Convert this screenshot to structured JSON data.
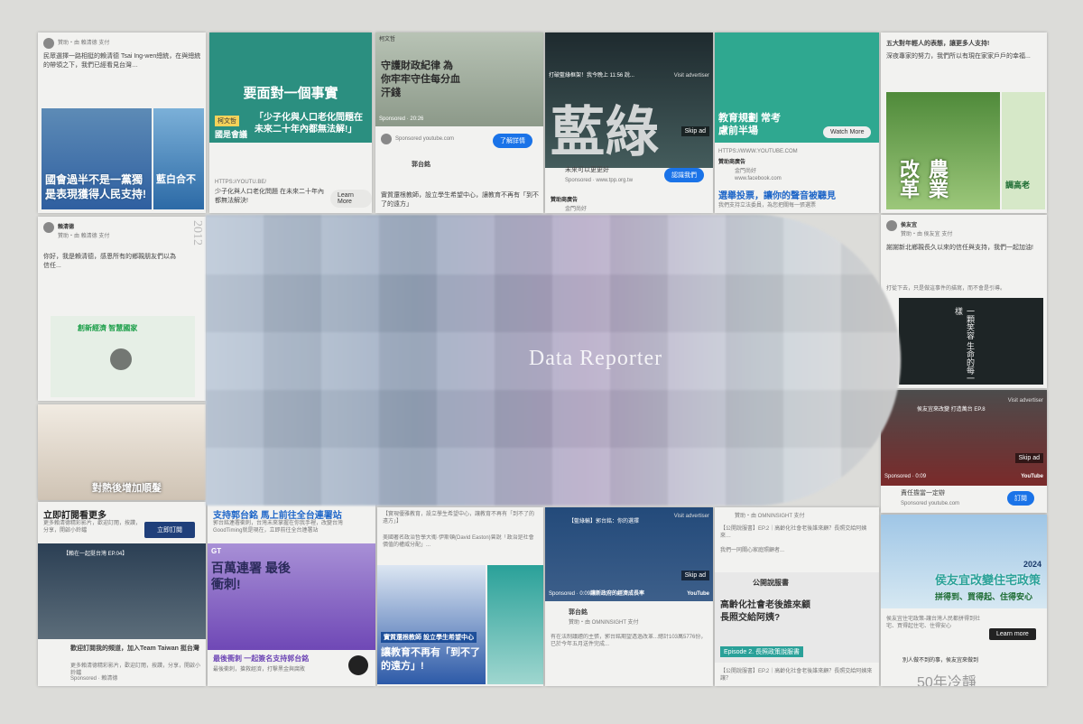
{
  "overlay_label": "Data Reporter",
  "cards": {
    "c1": {
      "header": "贊助・由 賴清德 支付",
      "body": "民眾選擇一路相挺的賴清德 Tsai Ing-wen總統，在與總統的帶領之下，我們已經看見台灣…",
      "caption1": "國會過半不是一黨獨大",
      "caption2": "是表現獲得人民支持!",
      "side": "藍白合不"
    },
    "c2": {
      "title": "要面對一個事實",
      "name_tag": "柯文哲",
      "tag2": "國是會議",
      "quote": "「少子化與人口老化問題在未來二十年內都無法解!」",
      "url": "HTTPS://YOUTU.BE/",
      "desc": "少子化與人口老化問題 在未來二十年內都無法解決!",
      "cta": "Learn More"
    },
    "c3": {
      "label": "柯文哲",
      "quote": "守護財政紀律 為你牢牢守住每分血汗錢",
      "sponsored": "Sponsored · 20:26",
      "sponsor_line": "Sponsored youtube.com",
      "cta": "了解詳情",
      "name": "郭台銘",
      "desc": "實質還根教師，設立學生希望中心，讓教育不再有「到不了的遠方」"
    },
    "c4": {
      "ad": "Visit advertiser",
      "title": "打破藍綠框架！我今晚上 11:56 說...",
      "skip": "Skip ad",
      "big": "藍綠",
      "desc": "未來可以更更好",
      "sponsored": "Sponsored · www.tpp.org.tw",
      "cta": "認識我們",
      "sponsor_group": "贊助商廣告",
      "name": "金門尚好"
    },
    "c5": {
      "title": "教育規劃 常考慮前半場",
      "watch": "Watch More",
      "url": "HTTPS://WWW.YOUTUBE.COM",
      "sponsor_group": "贊助商廣告",
      "name": "金門尚好",
      "site": "www.facebook.com",
      "headline": "選舉投票，讓你的聲音被聽見",
      "desc": "我們支持立法委員，為您把關每一張選票"
    },
    "c6": {
      "header": "五大對年輕人的表態，讓更多人支持!",
      "body": "深夜專家的努力，我們所以有現在家家戶戶的幸福...",
      "big": "農業改革",
      "side": "調高老"
    },
    "c7": {
      "name": "賴清德",
      "header": "贊助・由 賴清德 支付",
      "body": "你好，我是賴清德，感恩所有的鄉親朋友們以為信任...",
      "badge": "創新經濟 智慧國家",
      "vertical": "2012"
    },
    "c8": {
      "name": "侯友宜",
      "header": "贊助・由 侯友宜 支付",
      "body": "謝謝新北鄉親長久以來的信任與支持，我們一起加油!",
      "bottom": "打從下去，只是做這事件的描寫，而不會是引導。",
      "poster": "一顆笑容 生命的每一樣"
    },
    "c9": {
      "ad": "Visit advertiser",
      "title": "侯友宜來改變 打造萬台 EP.8",
      "skip": "Skip ad",
      "yt": "YouTube",
      "sponsored": "Sponsored · 0:09",
      "cta": "訂閱",
      "desc": "責任擔當一定辦",
      "sponsor": "Sponsored youtube.com"
    },
    "c10": {
      "caption": "對熱後增加順髮"
    },
    "c11": {
      "title": "立即訂閱看更多",
      "desc": "更多賴清德精彩影片，歡迎訂閱，按讚，分享，開啟小鈴鐺",
      "cta": "立即訂閱",
      "video": "【賴在一起挺台灣 EP.04】",
      "footer_title": "歡迎訂閱我的頻道，加入Team Taiwan 挺台灣",
      "footer_desc": "更多賴清德精彩影片，歡迎訂閱，按讚，分享，開啟小鈴鐺",
      "sponsored": "Sponsored · 賴清德"
    },
    "c12": {
      "title": "支持郭台銘 馬上前往全台連署站",
      "desc": "郭台銘連署衝刺，台灣未來掌握在你我手裡，改變台灣GoodTiming就是現在，立即前往全台連署站",
      "tag": "GT",
      "big": "百萬連署 最後衝刺!",
      "footer": "最後衝刺 一起簽名支持郭台銘",
      "sub": "最後衝刺，搶救經濟，打擊黑金與腐敗"
    },
    "c13": {
      "header": "【實現優雅教育，設立學生希望中心，讓教育不再有「到不了的遠方」】",
      "body": "美國著名政治哲學大衛·伊斯頓(David Easton)曾說「政治是社會價值的權威分配」...",
      "banner": "實質還根教師 設立學生希望中心",
      "big": "讓教育不再有「到不了的遠方」!"
    },
    "c14": {
      "title": "【藍綠輸】郭台銘：你的選擇",
      "ad": "Visit advertiser",
      "skip": "Skip ad",
      "yt": "YouTube",
      "sponsored": "Sponsored · 0:09",
      "caption": "讓新政府的經濟成長率",
      "name": "郭台銘",
      "header": "贊助・由 OMNINSIGHT 支付",
      "body": "有在法制議題的主張，郭台銘期望透過改革...總計103萬5776份，已於今年五月送件完成..."
    },
    "c15": {
      "header": "贊助・由 OMNINSIGHT 支付",
      "body": "【公開說服書】EP.2｜高齡化社會老後誰來顧？長照交給阿姨來…",
      "desc": "我們一同關心家庭照顧者...",
      "label": "公開說服書",
      "big": "高齡化社會老後誰來顧 長照交給阿姨?",
      "episode": "Episode 2. 長照政策說服書",
      "footer": "【公開說服書】EP.2｜高齡化社會老後誰來顧？長照交給阿姨來讓？"
    },
    "c16": {
      "big": "侯友宜改變住宅政策",
      "sub": "拼得到、買得起、住得安心",
      "year": "2024",
      "desc": "侯友宜住宅政策-讓台灣人民都拼得到社宅、買得起住宅、住得安心",
      "cta": "Learn more",
      "bottom": "別人做不到的事，侯友宜來做到",
      "bottom_big": "50年冷靜"
    }
  },
  "colors": {
    "green": "#1d9f4a",
    "blue": "#1e66c8",
    "purple": "#6f48b6",
    "teal": "#2aa199"
  }
}
